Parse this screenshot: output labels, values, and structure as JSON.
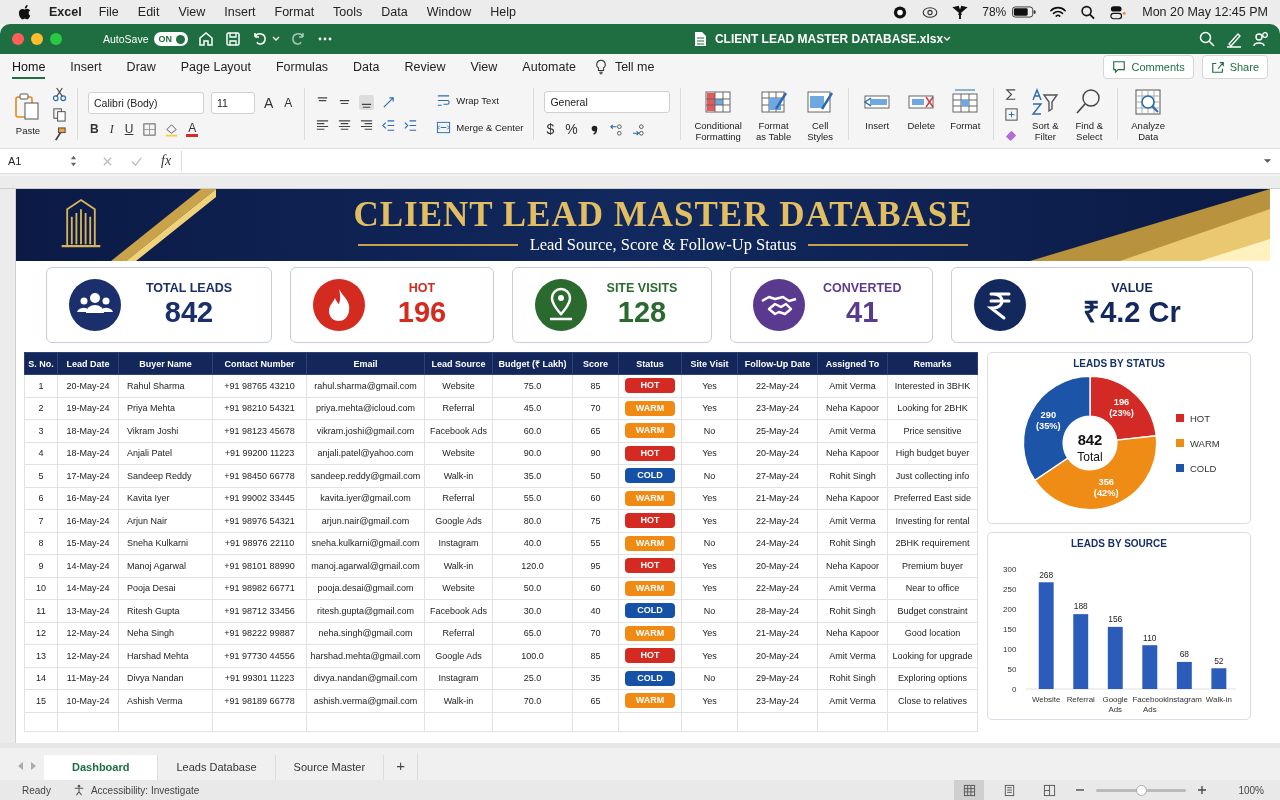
{
  "menubar": {
    "app": "Excel",
    "items": [
      "File",
      "Edit",
      "View",
      "Insert",
      "Format",
      "Tools",
      "Data",
      "Window",
      "Help"
    ],
    "battery": "78%",
    "clock": "Mon 20 May 12:45 PM"
  },
  "titlebar": {
    "autosave_label": "AutoSave",
    "autosave": {
      "label": "ON",
      "on": true
    },
    "filename": "CLIENT LEAD MASTER DATABASE.xlsx"
  },
  "ribbon_tabs": [
    {
      "label": "Home",
      "selected": true
    },
    {
      "label": "Insert",
      "selected": false
    },
    {
      "label": "Draw",
      "selected": false
    },
    {
      "label": "Page Layout",
      "selected": false
    },
    {
      "label": "Formulas",
      "selected": false
    },
    {
      "label": "Data",
      "selected": false
    },
    {
      "label": "Review",
      "selected": false
    },
    {
      "label": "View",
      "selected": false
    },
    {
      "label": "Automate",
      "selected": false
    }
  ],
  "tell_me": "Tell me",
  "comments": "Comments",
  "share": "Share",
  "ribbon": {
    "paste": "Paste",
    "font": "Calibri (Body)",
    "font_size": "11",
    "font_size_buttons": [
      "A",
      "A"
    ],
    "style_buttons": [
      "B",
      "I",
      "U"
    ],
    "font_color_button": "A",
    "wrap_text": "Wrap Text",
    "merge": "Merge & Center",
    "number_format": "General",
    "number_buttons": [
      "$",
      "%"
    ],
    "command_groups": [
      {
        "kind": "styles",
        "commands": [
          {
            "label": "Conditional\nFormatting",
            "kind": "conditional"
          },
          {
            "label": "Format\nas Table",
            "kind": "format_table"
          },
          {
            "label": "Cell\nStyles",
            "kind": "cell_styles"
          }
        ]
      },
      {
        "kind": "cells",
        "commands": [
          {
            "label": "Insert",
            "kind": "insert"
          },
          {
            "label": "Delete",
            "kind": "delete"
          },
          {
            "label": "Format",
            "kind": "format"
          }
        ]
      },
      {
        "kind": "editing",
        "commands": [
          {
            "label": "Sort &\nFilter",
            "kind": "sort_filter"
          },
          {
            "label": "Find &\nSelect",
            "kind": "find_select"
          }
        ]
      },
      {
        "kind": "analysis",
        "commands": [
          {
            "label": "Analyze\nData",
            "kind": "analyze"
          }
        ]
      }
    ]
  },
  "formula_bar": {
    "name_box": "A1",
    "function_label": "fx"
  },
  "banner": {
    "title": "CLIENT LEAD MASTER DATABASE",
    "subtitle": "Lead Source, Score & Follow-Up Status"
  },
  "kpis": [
    {
      "label": "TOTAL LEADS",
      "value": "842",
      "kind": "people",
      "color": "#1a2f6b"
    },
    {
      "label": "HOT",
      "value": "196",
      "kind": "fire",
      "color": "#d42b20"
    },
    {
      "label": "SITE VISITS",
      "value": "128",
      "kind": "pin",
      "color": "#2b6a2e"
    },
    {
      "label": "CONVERTED",
      "value": "41",
      "kind": "handshake",
      "color": "#5a3a8e"
    },
    {
      "label": "VALUE",
      "value": "₹4.2 Cr",
      "kind": "rupee",
      "color": "#13295e"
    }
  ],
  "table": {
    "columns": [
      "S. No.",
      "Lead Date",
      "Buyer Name",
      "Contact Number",
      "Email",
      "Lead Source",
      "Budget (₹ Lakh)",
      "Score",
      "Status",
      "Site Visit",
      "Follow-Up Date",
      "Assigned To",
      "Remarks"
    ],
    "rows": [
      {
        "s_no": "1",
        "lead_date": "20-May-24",
        "buyer_name": "Rahul Sharma",
        "contact": "+91 98765 43210",
        "email": "rahul.sharma@gmail.com",
        "source": "Website",
        "budget": "75.0",
        "score": "85",
        "status": {
          "label": "HOT",
          "kind": "hot"
        },
        "site_visit": "Yes",
        "follow_up": "22-May-24",
        "assigned_to": "Amit Verma",
        "remarks": "Interested in 3BHK"
      },
      {
        "s_no": "2",
        "lead_date": "19-May-24",
        "buyer_name": "Priya Mehta",
        "contact": "+91 98210 54321",
        "email": "priya.mehta@icloud.com",
        "source": "Referral",
        "budget": "45.0",
        "score": "70",
        "status": {
          "label": "WARM",
          "kind": "warm"
        },
        "site_visit": "Yes",
        "follow_up": "23-May-24",
        "assigned_to": "Neha Kapoor",
        "remarks": "Looking for 2BHK"
      },
      {
        "s_no": "3",
        "lead_date": "18-May-24",
        "buyer_name": "Vikram Joshi",
        "contact": "+91 98123 45678",
        "email": "vikram.joshi@gmail.com",
        "source": "Facebook Ads",
        "budget": "60.0",
        "score": "65",
        "status": {
          "label": "WARM",
          "kind": "warm"
        },
        "site_visit": "No",
        "follow_up": "25-May-24",
        "assigned_to": "Amit Verma",
        "remarks": "Price sensitive"
      },
      {
        "s_no": "4",
        "lead_date": "18-May-24",
        "buyer_name": "Anjali Patel",
        "contact": "+91 99200 11223",
        "email": "anjali.patel@yahoo.com",
        "source": "Website",
        "budget": "90.0",
        "score": "90",
        "status": {
          "label": "HOT",
          "kind": "hot"
        },
        "site_visit": "Yes",
        "follow_up": "20-May-24",
        "assigned_to": "Neha Kapoor",
        "remarks": "High budget buyer"
      },
      {
        "s_no": "5",
        "lead_date": "17-May-24",
        "buyer_name": "Sandeep Reddy",
        "contact": "+91 98450 66778",
        "email": "sandeep.reddy@gmail.com",
        "source": "Walk-in",
        "budget": "35.0",
        "score": "50",
        "status": {
          "label": "COLD",
          "kind": "cold"
        },
        "site_visit": "No",
        "follow_up": "27-May-24",
        "assigned_to": "Rohit Singh",
        "remarks": "Just collecting info"
      },
      {
        "s_no": "6",
        "lead_date": "16-May-24",
        "buyer_name": "Kavita Iyer",
        "contact": "+91 99002 33445",
        "email": "kavita.iyer@gmail.com",
        "source": "Referral",
        "budget": "55.0",
        "score": "60",
        "status": {
          "label": "WARM",
          "kind": "warm"
        },
        "site_visit": "Yes",
        "follow_up": "21-May-24",
        "assigned_to": "Neha Kapoor",
        "remarks": "Preferred East side"
      },
      {
        "s_no": "7",
        "lead_date": "16-May-24",
        "buyer_name": "Arjun Nair",
        "contact": "+91 98976 54321",
        "email": "arjun.nair@gmail.com",
        "source": "Google Ads",
        "budget": "80.0",
        "score": "75",
        "status": {
          "label": "HOT",
          "kind": "hot"
        },
        "site_visit": "Yes",
        "follow_up": "22-May-24",
        "assigned_to": "Amit Verma",
        "remarks": "Investing for rental"
      },
      {
        "s_no": "8",
        "lead_date": "15-May-24",
        "buyer_name": "Sneha Kulkarni",
        "contact": "+91 98976 22110",
        "email": "sneha.kulkarni@gmail.com",
        "source": "Instagram",
        "budget": "40.0",
        "score": "55",
        "status": {
          "label": "WARM",
          "kind": "warm"
        },
        "site_visit": "No",
        "follow_up": "24-May-24",
        "assigned_to": "Rohit Singh",
        "remarks": "2BHK requirement"
      },
      {
        "s_no": "9",
        "lead_date": "14-May-24",
        "buyer_name": "Manoj Agarwal",
        "contact": "+91 98101 88990",
        "email": "manoj.agarwal@gmail.com",
        "source": "Walk-in",
        "budget": "120.0",
        "score": "95",
        "status": {
          "label": "HOT",
          "kind": "hot"
        },
        "site_visit": "Yes",
        "follow_up": "20-May-24",
        "assigned_to": "Neha Kapoor",
        "remarks": "Premium buyer"
      },
      {
        "s_no": "10",
        "lead_date": "14-May-24",
        "buyer_name": "Pooja Desai",
        "contact": "+91 98982 66771",
        "email": "pooja.desai@gmail.com",
        "source": "Website",
        "budget": "50.0",
        "score": "60",
        "status": {
          "label": "WARM",
          "kind": "warm"
        },
        "site_visit": "Yes",
        "follow_up": "22-May-24",
        "assigned_to": "Amit Verma",
        "remarks": "Near to office"
      },
      {
        "s_no": "11",
        "lead_date": "13-May-24",
        "buyer_name": "Ritesh Gupta",
        "contact": "+91 98712 33456",
        "email": "ritesh.gupta@gmail.com",
        "source": "Facebook Ads",
        "budget": "30.0",
        "score": "40",
        "status": {
          "label": "COLD",
          "kind": "cold"
        },
        "site_visit": "No",
        "follow_up": "28-May-24",
        "assigned_to": "Rohit Singh",
        "remarks": "Budget constraint"
      },
      {
        "s_no": "12",
        "lead_date": "12-May-24",
        "buyer_name": "Neha Singh",
        "contact": "+91 98222 99887",
        "email": "neha.singh@gmail.com",
        "source": "Referral",
        "budget": "65.0",
        "score": "70",
        "status": {
          "label": "WARM",
          "kind": "warm"
        },
        "site_visit": "Yes",
        "follow_up": "21-May-24",
        "assigned_to": "Neha Kapoor",
        "remarks": "Good location"
      },
      {
        "s_no": "13",
        "lead_date": "12-May-24",
        "buyer_name": "Harshad Mehta",
        "contact": "+91 97730 44556",
        "email": "harshad.mehta@gmail.com",
        "source": "Google Ads",
        "budget": "100.0",
        "score": "85",
        "status": {
          "label": "HOT",
          "kind": "hot"
        },
        "site_visit": "Yes",
        "follow_up": "20-May-24",
        "assigned_to": "Amit Verma",
        "remarks": "Looking for upgrade"
      },
      {
        "s_no": "14",
        "lead_date": "11-May-24",
        "buyer_name": "Divya Nandan",
        "contact": "+91 99301 11223",
        "email": "divya.nandan@gmail.com",
        "source": "Instagram",
        "budget": "25.0",
        "score": "35",
        "status": {
          "label": "COLD",
          "kind": "cold"
        },
        "site_visit": "No",
        "follow_up": "29-May-24",
        "assigned_to": "Rohit Singh",
        "remarks": "Exploring options"
      },
      {
        "s_no": "15",
        "lead_date": "10-May-24",
        "buyer_name": "Ashish Verma",
        "contact": "+91 98189 66778",
        "email": "ashish.verma@gmail.com",
        "source": "Walk-in",
        "budget": "70.0",
        "score": "65",
        "status": {
          "label": "WARM",
          "kind": "warm"
        },
        "site_visit": "Yes",
        "follow_up": "23-May-24",
        "assigned_to": "Amit Verma",
        "remarks": "Close to relatives"
      }
    ]
  },
  "charts": {
    "status": {
      "chart_data": {
        "type": "donut",
        "title": "LEADS BY STATUS",
        "categories": [
          "HOT",
          "WARM",
          "COLD"
        ],
        "colors": [
          "#d32a25",
          "#ef8c16",
          "#1c54a8"
        ],
        "series": [
          {
            "values": [
              196,
              356,
              290
            ]
          }
        ],
        "data_labels": true,
        "value_labels": [
          "(23%)",
          "(42%)",
          "(35%)"
        ],
        "legend": true
      },
      "center_value": "842",
      "center_label": "Total"
    },
    "source": {
      "chart_data": {
        "type": "bar",
        "title": "LEADS BY SOURCE",
        "categories": [
          "Website",
          "Referral",
          "Google Ads",
          "Facebook Ads",
          "Instagram",
          "Walk-in"
        ],
        "series": [
          {
            "color": "#2c5cb9",
            "values": [
              268,
              188,
              156,
              110,
              68,
              52
            ]
          }
        ],
        "ylim": [
          0,
          300
        ],
        "yticks": [
          0,
          50,
          100,
          150,
          200,
          250,
          300
        ],
        "data_labels": true
      }
    }
  },
  "sheet_tabs": [
    {
      "label": "Dashboard",
      "selected": true
    },
    {
      "label": "Leads Database",
      "selected": false
    },
    {
      "label": "Source Master",
      "selected": false
    }
  ],
  "add_sheet": "+",
  "status_bar": {
    "ready": "Ready",
    "accessibility": "Accessibility: Investigate",
    "views": [
      {
        "kind": "normal",
        "selected": true
      },
      {
        "kind": "page_layout",
        "selected": false
      },
      {
        "kind": "page_break",
        "selected": false
      }
    ],
    "zoom_slider": {
      "level": 0.5
    },
    "zoom": "100%"
  }
}
